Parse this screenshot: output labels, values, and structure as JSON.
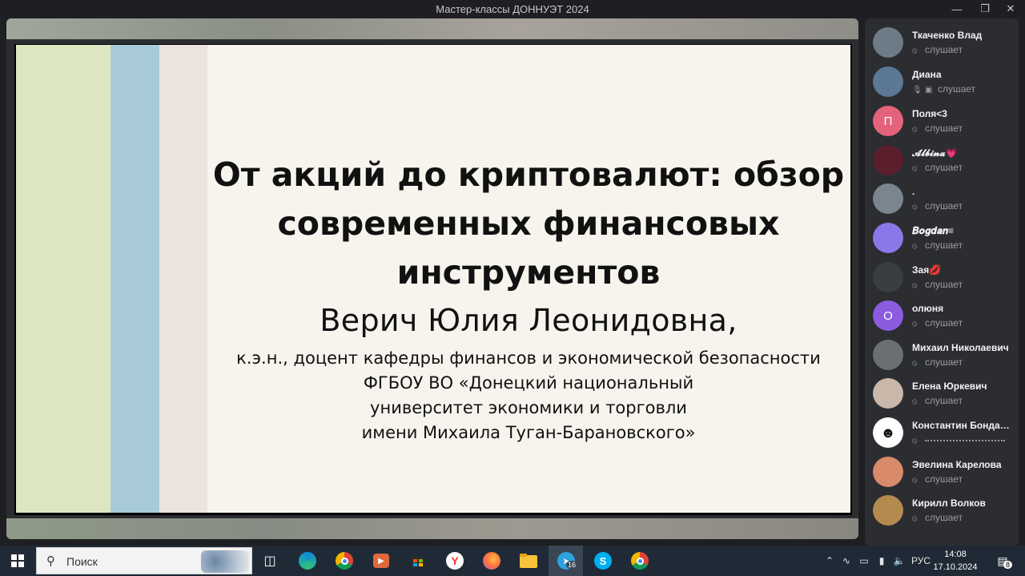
{
  "window": {
    "title": "Мастер-классы ДОННУЭТ 2024"
  },
  "slide": {
    "title": "От акций до криптовалют: обзор современных финансовых инструментов",
    "author": "Верич Юлия Леонидовна,",
    "affiliation": [
      "к.э.н., доцент кафедры финансов и экономической безопасности",
      "ФГБОУ ВО «Донецкий национальный",
      "университет экономики и торговли",
      "имени Михаила Туган-Барановского»"
    ]
  },
  "participants": [
    {
      "name": "Ткаченко Влад",
      "status": "слушает",
      "initial": "",
      "color": "#6d7b86"
    },
    {
      "name": "Диана",
      "status": "слушает",
      "initial": "",
      "color": "#5c7895"
    },
    {
      "name": "Поля<3",
      "status": "слушает",
      "initial": "П",
      "color": "#e4637a"
    },
    {
      "name": "𝓐𝓵𝓫𝓲𝓷𝓪💗",
      "status": "слушает",
      "initial": "",
      "color": "#5a1f2a"
    },
    {
      "name": ".",
      "status": "слушает",
      "initial": "",
      "color": "#7b858f"
    },
    {
      "name": "𝑩𝒐𝒈𝒅𝒂𝒏≡",
      "status": "слушает",
      "initial": "",
      "color": "#8a78e8"
    },
    {
      "name": "Зая💋",
      "status": "слушает",
      "initial": "",
      "color": "#3a3d42"
    },
    {
      "name": "олюня",
      "status": "слушает",
      "initial": "О",
      "color": "#8b5ce0"
    },
    {
      "name": "Михаил Николаевич",
      "status": "слушает",
      "initial": "",
      "color": "#6b6f74"
    },
    {
      "name": "Елена Юркевич",
      "status": "слушает",
      "initial": "",
      "color": "#c9b7a9"
    },
    {
      "name": "Константин Бондаренко",
      "status": "",
      "initial": "",
      "color": "#ffffff"
    },
    {
      "name": "Эвелина Карелова",
      "status": "слушает",
      "initial": "",
      "color": "#d98a6a"
    },
    {
      "name": "Кирилл Волков",
      "status": "слушает",
      "initial": "",
      "color": "#b58a4f"
    }
  ],
  "taskbar": {
    "search_label": "Поиск",
    "telegram_badge": "16",
    "lang": "РУС",
    "time": "14:08",
    "date": "17.10.2024",
    "notifications": "8"
  },
  "colors": {
    "stripe1": "#dce7c2",
    "stripe2": "#a9cad9",
    "stripe3": "#ebe3dc"
  }
}
